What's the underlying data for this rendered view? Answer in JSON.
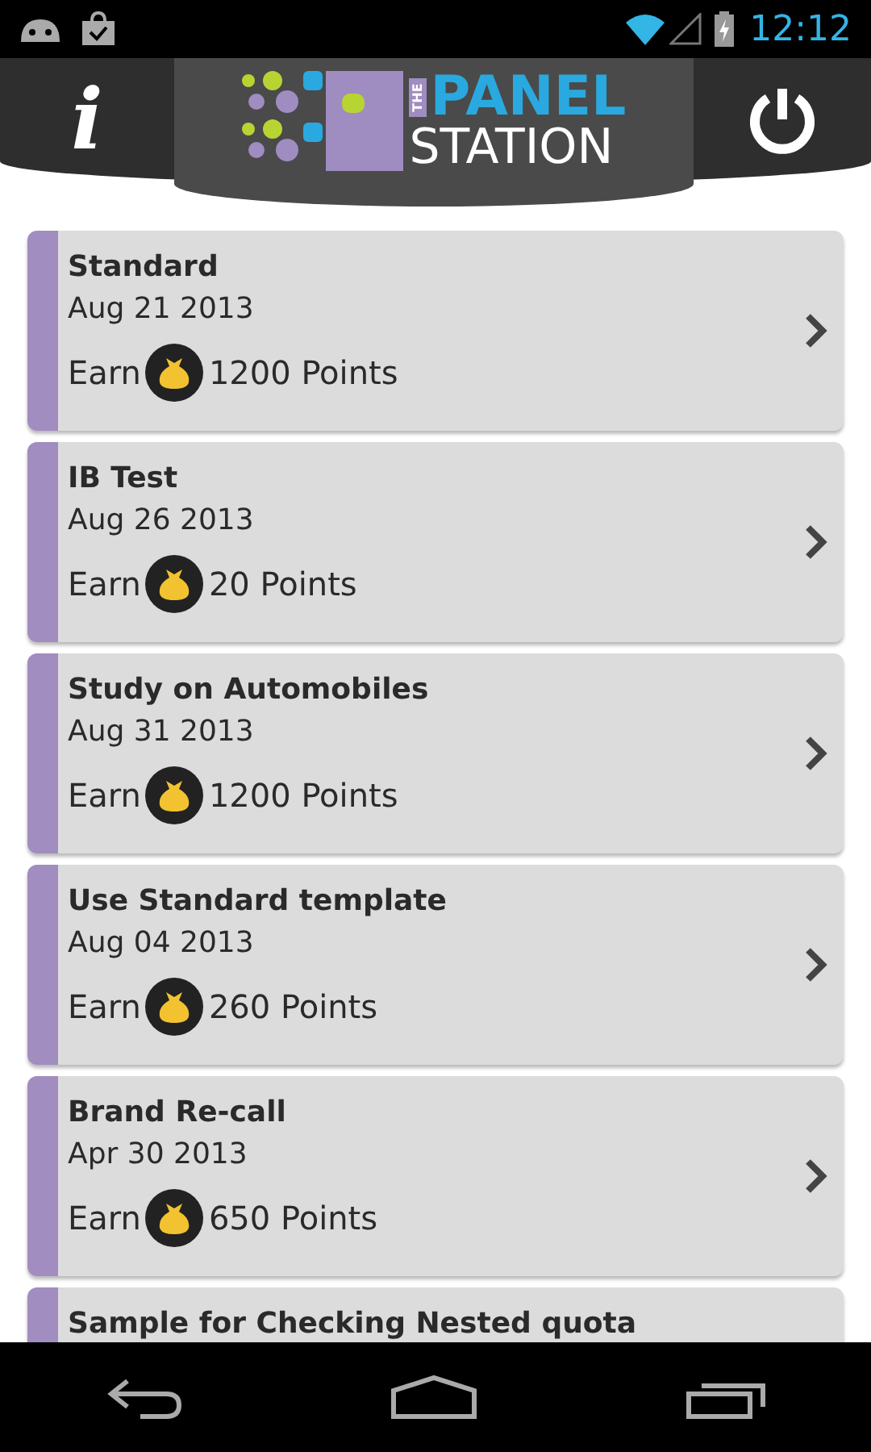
{
  "status_bar": {
    "time": "12:12"
  },
  "header": {
    "info": "i",
    "logo": {
      "small": "THE",
      "top": "PANEL",
      "bottom": "STATION"
    }
  },
  "surveys": [
    {
      "title": "Standard",
      "date": "Aug 21 2013",
      "earn": "Earn",
      "points": "1200 Points"
    },
    {
      "title": "IB Test",
      "date": "Aug 26 2013",
      "earn": "Earn",
      "points": "20 Points"
    },
    {
      "title": "Study on Automobiles",
      "date": "Aug 31 2013",
      "earn": "Earn",
      "points": "1200 Points"
    },
    {
      "title": "Use Standard template",
      "date": "Aug 04 2013",
      "earn": "Earn",
      "points": "260 Points"
    },
    {
      "title": "Brand Re-call",
      "date": "Apr 30 2013",
      "earn": "Earn",
      "points": "650 Points"
    },
    {
      "title": "Sample for Checking Nested quota"
    }
  ]
}
